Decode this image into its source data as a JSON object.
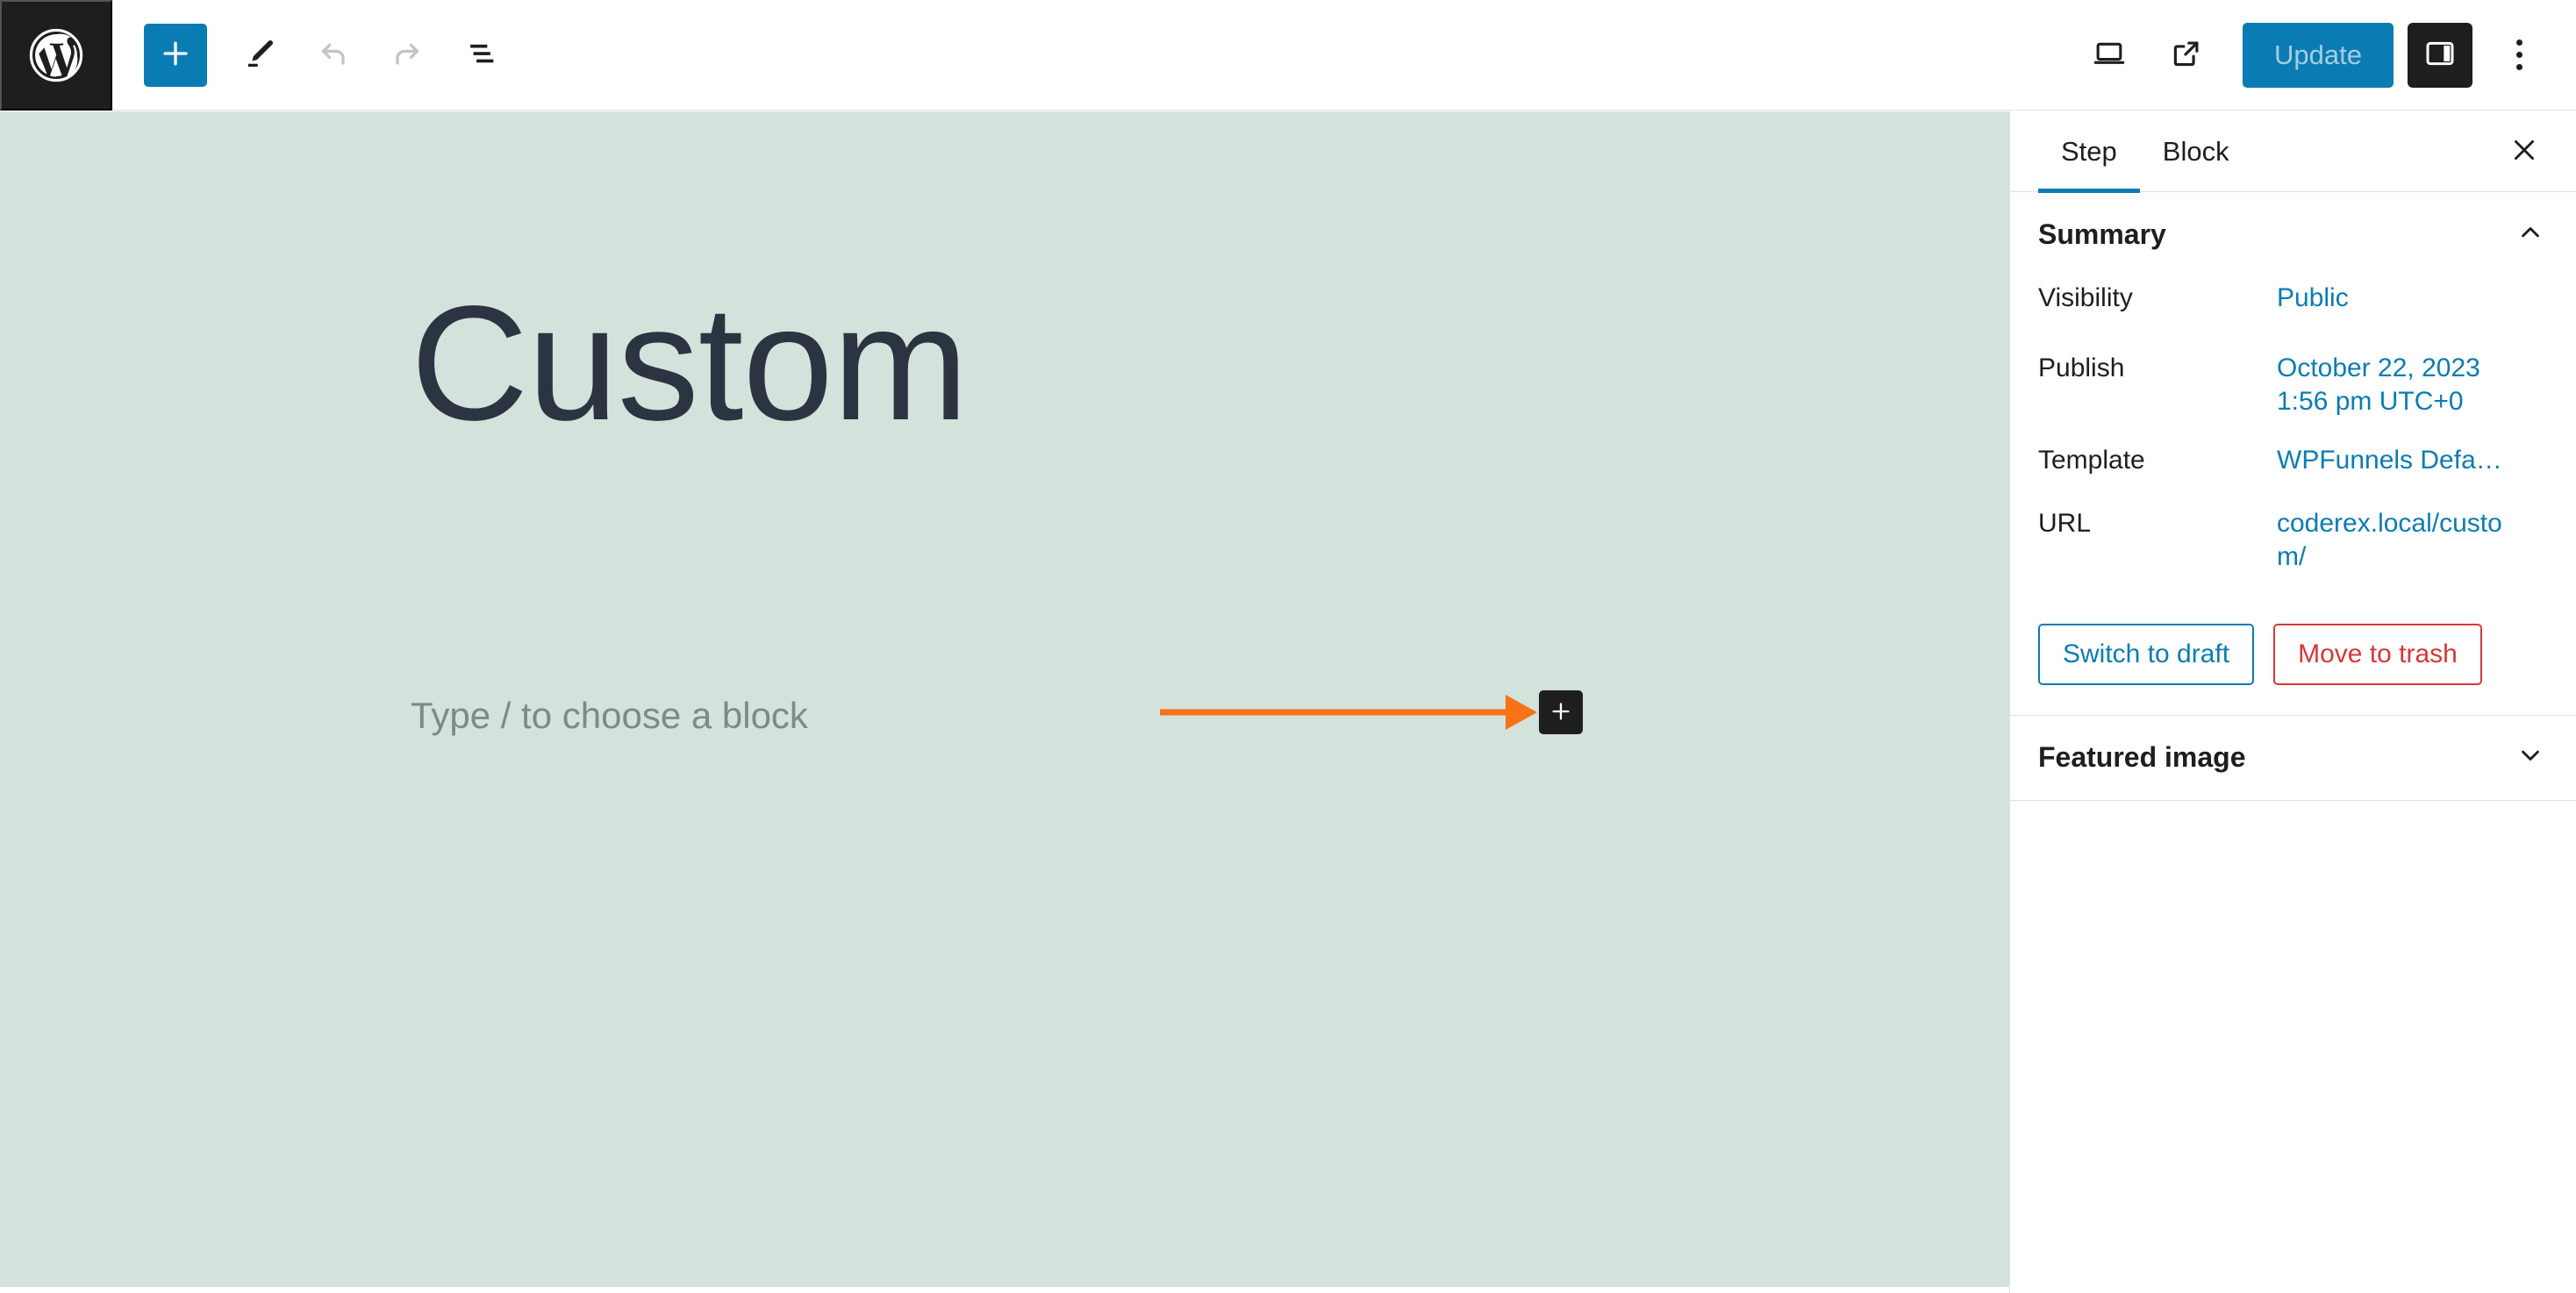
{
  "toolbar": {
    "logo_icon": "wordpress-logo-icon",
    "add_block_label": "+",
    "add_block_icon": "plus-icon",
    "edit_tool_icon": "pencil-icon",
    "undo_icon": "undo-arrow-icon",
    "redo_icon": "redo-arrow-icon",
    "list_view_icon": "list-view-icon",
    "preview_icon": "desktop-preview-icon",
    "view_external_icon": "external-link-icon",
    "update_label": "Update",
    "sidebar_toggle_icon": "sidebar-panel-icon",
    "options_icon": "kebab-menu-icon",
    "accent_blue": "#0b7cb3",
    "dark": "#1e1e1e"
  },
  "canvas": {
    "background_color": "#d3e2db",
    "post_title": "Custom",
    "block_placeholder": "Type / to choose a block",
    "inserter_icon": "plus-icon",
    "annotation_arrow_color": "#f97316"
  },
  "sidebar": {
    "tabs": [
      {
        "label": "Step",
        "active": true
      },
      {
        "label": "Block",
        "active": false
      }
    ],
    "close_icon": "close-icon",
    "panels": [
      {
        "title": "Summary",
        "expanded": true,
        "chevron_icon": "chevron-up-icon"
      },
      {
        "title": "Featured image",
        "expanded": false,
        "chevron_icon": "chevron-down-icon"
      }
    ],
    "summary": {
      "rows": [
        {
          "label": "Visibility",
          "value": "Public"
        },
        {
          "label": "Publish",
          "value": "October 22, 2023 1:56 pm UTC+0"
        },
        {
          "label": "Template",
          "value": "WPFunnels Defa…"
        },
        {
          "label": "URL",
          "value": "coderex.local/custom/"
        }
      ]
    },
    "actions": {
      "switch_to_draft": "Switch to draft",
      "move_to_trash": "Move to trash"
    },
    "link_color": "#0b7cb3",
    "danger_color": "#d63638"
  }
}
